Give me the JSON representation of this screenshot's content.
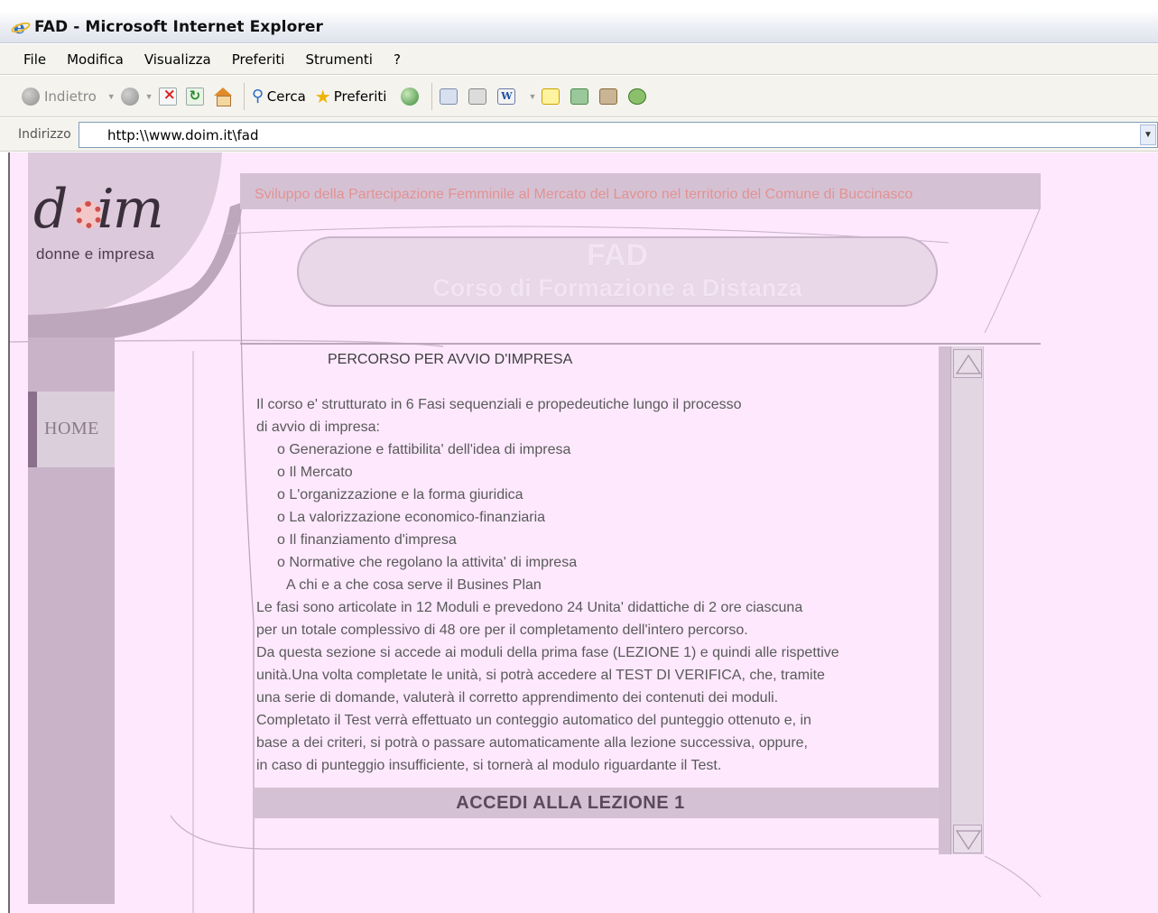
{
  "window": {
    "title": "FAD - Microsoft Internet Explorer"
  },
  "menu": [
    "File",
    "Modifica",
    "Visualizza",
    "Preferiti",
    "Strumenti",
    "?"
  ],
  "toolbar": {
    "back_label": "Indietro",
    "search_label": "Cerca",
    "favorites_label": "Preferiti"
  },
  "address": {
    "label": "Indirizzo",
    "url": "http:\\\\www.doim.it\\fad"
  },
  "page": {
    "logo_text": "d im",
    "logo_sub": "donne e impresa",
    "header": "Sviluppo della Partecipazione Femminile al Mercato del Lavoro nel territorio del Comune di Buccinasco",
    "fad_title": "FAD",
    "fad_sub": "Corso di Formazione a Distanza",
    "home": "HOME",
    "panel_title": "PERCORSO PER AVVIO D'IMPRESA",
    "intro_lines": [
      "Il corso e' strutturato in 6 Fasi sequenziali e propedeutiche lungo il processo",
      "di avvio di impresa:"
    ],
    "bullets": [
      "o  Generazione e fattibilita' dell'idea di impresa",
      "o  Il Mercato",
      "o  L'organizzazione e la forma giuridica",
      "o  La valorizzazione economico-finanziaria",
      "o  Il finanziamento d'impresa",
      "o  Normative che regolano la attivita' di impresa",
      "   A chi e a che cosa serve il Busines Plan"
    ],
    "body_lines": [
      "Le fasi sono articolate in 12 Moduli e prevedono 24 Unita' didattiche di 2 ore ciascuna",
      "per un totale complessivo di 48 ore per il completamento dell'intero percorso.",
      "Da questa sezione si accede ai moduli della prima fase (LEZIONE 1) e quindi alle rispettive",
      "unità.Una volta completate le unità, si potrà accedere al TEST DI VERIFICA, che, tramite",
      "una serie di domande, valuterà il corretto apprendimento dei contenuti dei moduli.",
      "Completato il Test verrà effettuato un conteggio automatico del punteggio ottenuto e, in",
      "base a dei criteri, si potrà  o passare automaticamente alla lezione successiva, oppure,",
      "in caso di punteggio insufficiente, si tornerà al modulo riguardante il Test."
    ],
    "access_label": "ACCEDI ALLA LEZIONE 1"
  }
}
